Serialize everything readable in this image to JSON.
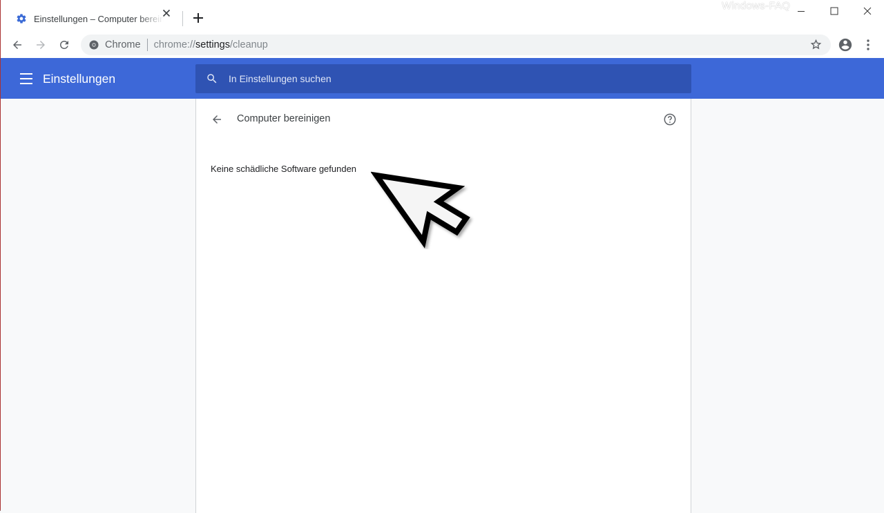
{
  "browser": {
    "tab": {
      "title": "Einstellungen – Computer bereinigen",
      "favicon": "gear-icon",
      "close_icon": "close-icon"
    },
    "new_tab_icon": "plus-icon",
    "watermark": "Windows-FAQ",
    "window_controls": {
      "minimize": "minimize-icon",
      "maximize": "maximize-icon",
      "close": "close-icon"
    },
    "toolbar": {
      "back_icon": "arrow-left-icon",
      "forward_icon": "arrow-right-icon",
      "reload_icon": "reload-icon",
      "site_chip": "Chrome",
      "url_prefix": "chrome://",
      "url_host": "settings",
      "url_path": "/cleanup",
      "bookmark_icon": "star-icon",
      "profile_icon": "account-circle-icon",
      "menu_icon": "more-vert-icon"
    }
  },
  "settings": {
    "header": {
      "menu_icon": "hamburger-icon",
      "title": "Einstellungen",
      "search_placeholder": "In Einstellungen suchen",
      "search_value": ""
    },
    "page": {
      "back_icon": "arrow-left-icon",
      "title": "Computer bereinigen",
      "help_icon": "help-circle-icon",
      "status": "Keine schädliche Software gefunden"
    }
  },
  "colors": {
    "header_bg": "#3d68d8",
    "search_bg": "#2f53b3",
    "favicon_blue": "#3b6bd6",
    "page_bg": "#f8f9fa"
  },
  "annotation": {
    "type": "pointer-arrow",
    "points_to": "status"
  }
}
